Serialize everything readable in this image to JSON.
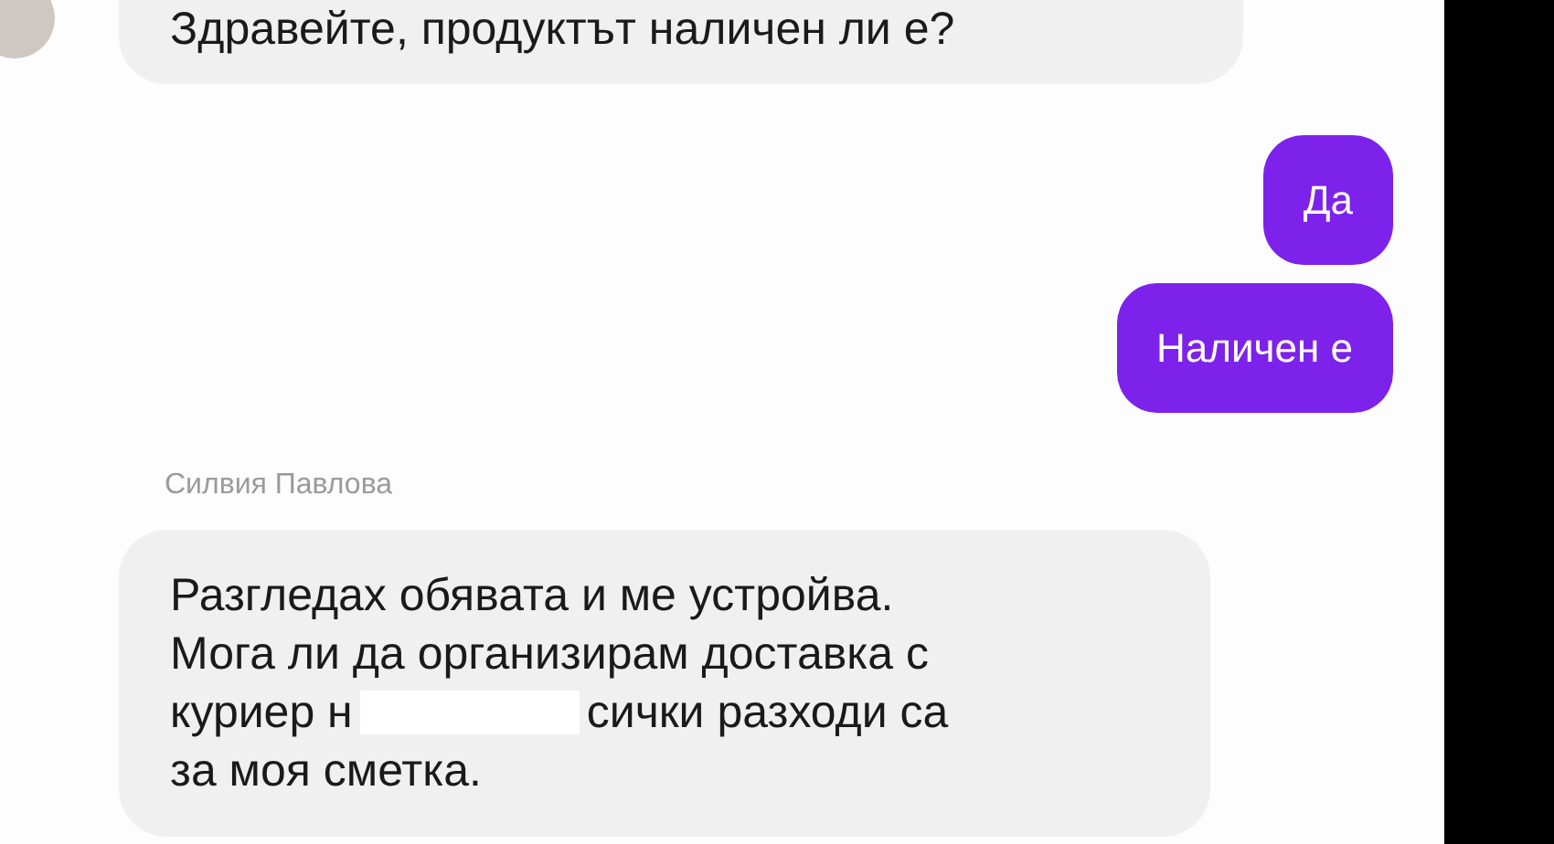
{
  "messages": [
    {
      "kind": "incoming",
      "lines": [
        {
          "text": "Здравейте, продуктът наличен ли е?"
        }
      ]
    },
    {
      "kind": "outgoing",
      "lines": [
        {
          "text": "Да"
        }
      ]
    },
    {
      "kind": "outgoing",
      "lines": [
        {
          "text": "Наличен е"
        }
      ]
    },
    {
      "kind": "sender",
      "lines": [
        {
          "text": "Силвия Павлова"
        }
      ]
    },
    {
      "kind": "incoming",
      "lines": [
        {
          "text": "Разгледах обявата и ме устройва."
        },
        {
          "text": "Мога ли да организирам доставка с"
        },
        {
          "text": "куриер н",
          "redacted": true,
          "after": "сички разходи са"
        },
        {
          "text": "за моя сметка."
        }
      ]
    }
  ]
}
